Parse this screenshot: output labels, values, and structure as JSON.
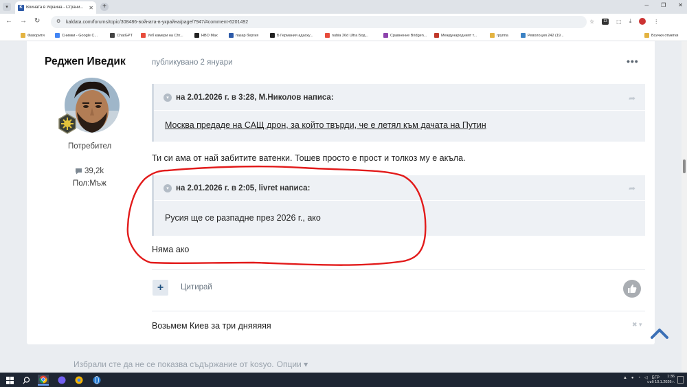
{
  "browser": {
    "tab_title": "Войната в Украйна - Страни...",
    "tab_favicon": "K",
    "url": "kaldata.com/forums/topic/308486-войната-в-украйна/page/7947/#comment-6201492",
    "bookmarks": [
      {
        "label": "Фаворити",
        "color": "#e3b341"
      },
      {
        "label": "Снимки - Google С...",
        "color": "#4285f4"
      },
      {
        "label": "ChatGPT",
        "color": "#444444"
      },
      {
        "label": "Уеб камери на Chr...",
        "color": "#e74c3c"
      },
      {
        "label": "HBO Max",
        "color": "#222222"
      },
      {
        "label": "пазар бергия",
        "color": "#2d5aa8"
      },
      {
        "label": "Б Германия адаску...",
        "color": "#222222"
      },
      {
        "label": "nubia 26d Ultra Бод...",
        "color": "#e74c3c"
      },
      {
        "label": "Сравнение Bridgen...",
        "color": "#8e44ad"
      },
      {
        "label": "Международният т...",
        "color": "#c0392b"
      },
      {
        "label": "группа",
        "color": "#e3b341"
      },
      {
        "label": "Револоция 242 (19...",
        "color": "#3b82c4"
      },
      {
        "label": "Всички отметки",
        "color": "#e3b341"
      }
    ],
    "profile_badge": "13"
  },
  "author": {
    "name": "Реджеп Иведик",
    "role": "Потребител",
    "posts": "39,2k",
    "gender": "Пол:Мъж"
  },
  "post": {
    "date": "публикувано 2 януари",
    "more": "•••",
    "quote1": {
      "header": "на 2.01.2026 г. в 3:28, М.Николов написа:",
      "body": "Москва предаде на САЩ дрон, за който твърди, че е летял към дачата на Путин"
    },
    "reply1": "Ти си ама от най забитите ватенки. Тошев просто е прост и толкоз му е акъла.",
    "quote2": {
      "header": "на 2.01.2026 г. в 2:05, livret написа:",
      "body": "Русия ще се разпадне през 2026 г., ако"
    },
    "reply2": "Няма ако",
    "actions": {
      "plus": "+",
      "quote": "Цитирай"
    },
    "signature": "Возьмем Киев за три дняяяяя"
  },
  "notice": {
    "text": "Избрали сте да не се показва съдържание от kosyo.",
    "options": "Опции ▾"
  },
  "system": {
    "tray_lang": "БГР",
    "time": "1:36",
    "date": "съб 10.1.2026 г."
  },
  "colors": {
    "accent": "#1d4f7d",
    "annotation": "#e21b1b",
    "quote_bg": "#eef1f5",
    "back_to_top": "#3b6fb6"
  }
}
